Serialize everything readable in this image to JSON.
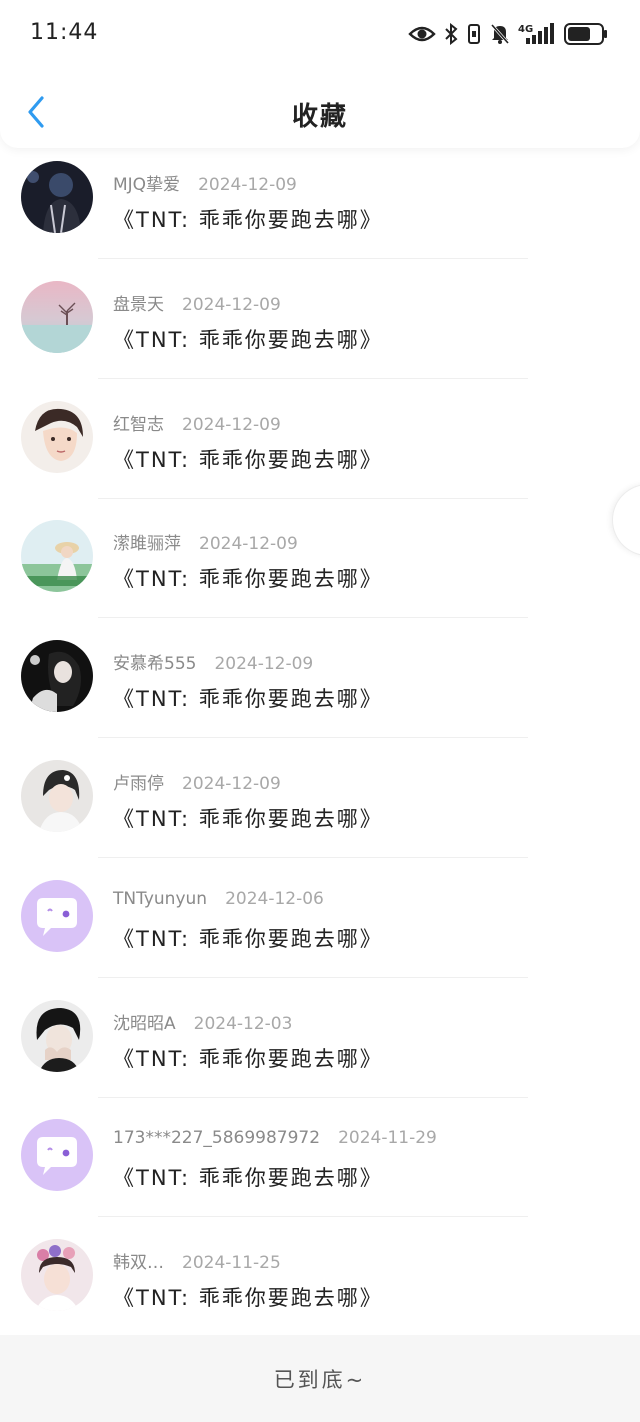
{
  "status_bar": {
    "time": "11:44",
    "icons": [
      "eye-icon",
      "bluetooth-icon",
      "vibrate-icon",
      "mute-bell-icon",
      "signal-4g-icon",
      "battery-icon"
    ],
    "network_label": "4G"
  },
  "nav": {
    "back_icon": "chevron-left-icon",
    "title": "收藏",
    "accent_color": "#2f9bf0"
  },
  "items": [
    {
      "name": "MJQ挚爱",
      "date": "2024-12-09",
      "title": "《TNT: 乖乖你要跑去哪》",
      "avatar": "photo-dark-performer"
    },
    {
      "name": "盘景天",
      "date": "2024-12-09",
      "title": "《TNT: 乖乖你要跑去哪》",
      "avatar": "pink-landscape-tree"
    },
    {
      "name": "红智志",
      "date": "2024-12-09",
      "title": "《TNT: 乖乖你要跑去哪》",
      "avatar": "anime-boy"
    },
    {
      "name": "潆雎骊萍",
      "date": "2024-12-09",
      "title": "《TNT: 乖乖你要跑去哪》",
      "avatar": "girl-field-hat"
    },
    {
      "name": "安慕希555",
      "date": "2024-12-09",
      "title": "《TNT: 乖乖你要跑去哪》",
      "avatar": "black-white-girl"
    },
    {
      "name": "卢雨停",
      "date": "2024-12-09",
      "title": "《TNT: 乖乖你要跑去哪》",
      "avatar": "girl-portrait"
    },
    {
      "name": "TNTyunyun",
      "date": "2024-12-06",
      "title": "《TNT: 乖乖你要跑去哪》",
      "avatar": "default-purple-chat"
    },
    {
      "name": "沈昭昭A",
      "date": "2024-12-03",
      "title": "《TNT: 乖乖你要跑去哪》",
      "avatar": "dark-hair-boy"
    },
    {
      "name": "173***227_5869987972",
      "date": "2024-11-29",
      "title": "《TNT: 乖乖你要跑去哪》",
      "avatar": "default-purple-chat"
    },
    {
      "name": "韩双…",
      "date": "2024-11-25",
      "title": "《TNT: 乖乖你要跑去哪》",
      "avatar": "girl-flower-crown"
    }
  ],
  "footer": {
    "text": "已到底~"
  }
}
